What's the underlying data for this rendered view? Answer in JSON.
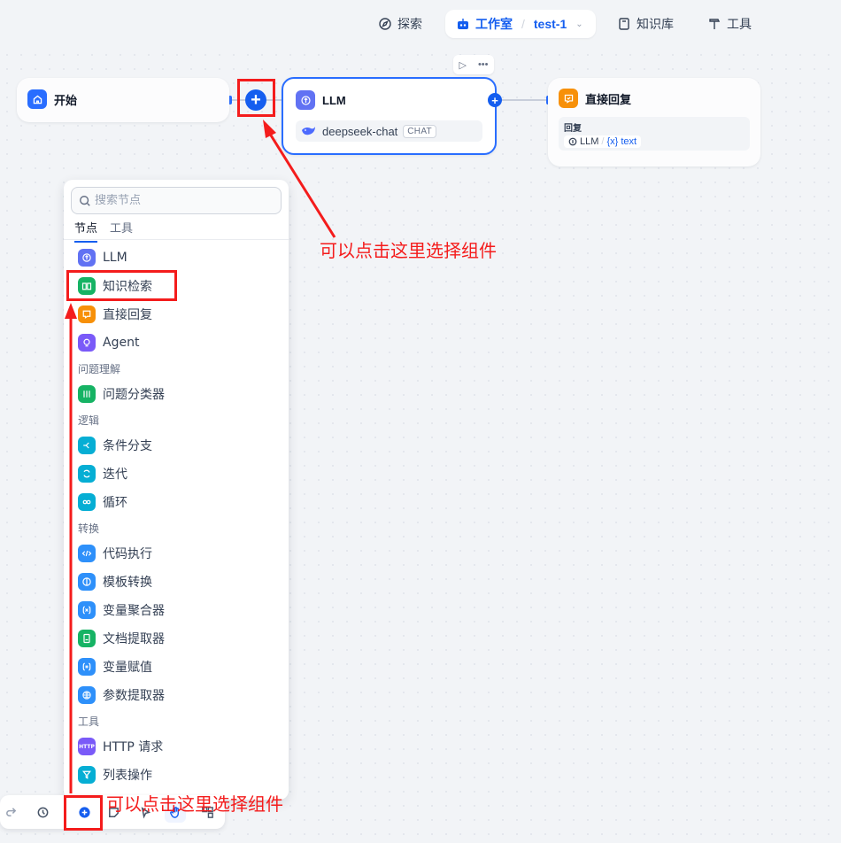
{
  "nav": {
    "explore": "探索",
    "studio": "工作室",
    "app_name": "test-1",
    "knowledge": "知识库",
    "tools": "工具"
  },
  "nodes": {
    "start": {
      "title": "开始"
    },
    "llm": {
      "title": "LLM",
      "model": "deepseek-chat",
      "mode_tag": "CHAT"
    },
    "reply": {
      "title": "直接回复",
      "field_label": "回复",
      "var_source": "LLM",
      "var_sep": "/",
      "var_name": "{x} text"
    }
  },
  "panel": {
    "search_placeholder": "搜索节点",
    "tabs": [
      "节点",
      "工具"
    ],
    "items": {
      "llm": "LLM",
      "knowledge": "知识检索",
      "reply": "直接回复",
      "agent": "Agent",
      "classifier": "问题分类器",
      "if_else": "条件分支",
      "iteration": "迭代",
      "loop": "循环",
      "code": "代码执行",
      "template": "模板转换",
      "var_agg": "变量聚合器",
      "doc_extract": "文档提取器",
      "var_assign": "变量赋值",
      "param_extract": "参数提取器",
      "http": "HTTP 请求",
      "list_op": "列表操作"
    },
    "groups": {
      "understanding": "问题理解",
      "logic": "逻辑",
      "transform": "转换",
      "tools": "工具"
    }
  },
  "annotations": {
    "top_hint": "可以点击这里选择组件",
    "bottom_hint": "可以点击这里选择组件"
  },
  "colors": {
    "accent": "#155eef",
    "annotation_red": "#f41c1c"
  }
}
